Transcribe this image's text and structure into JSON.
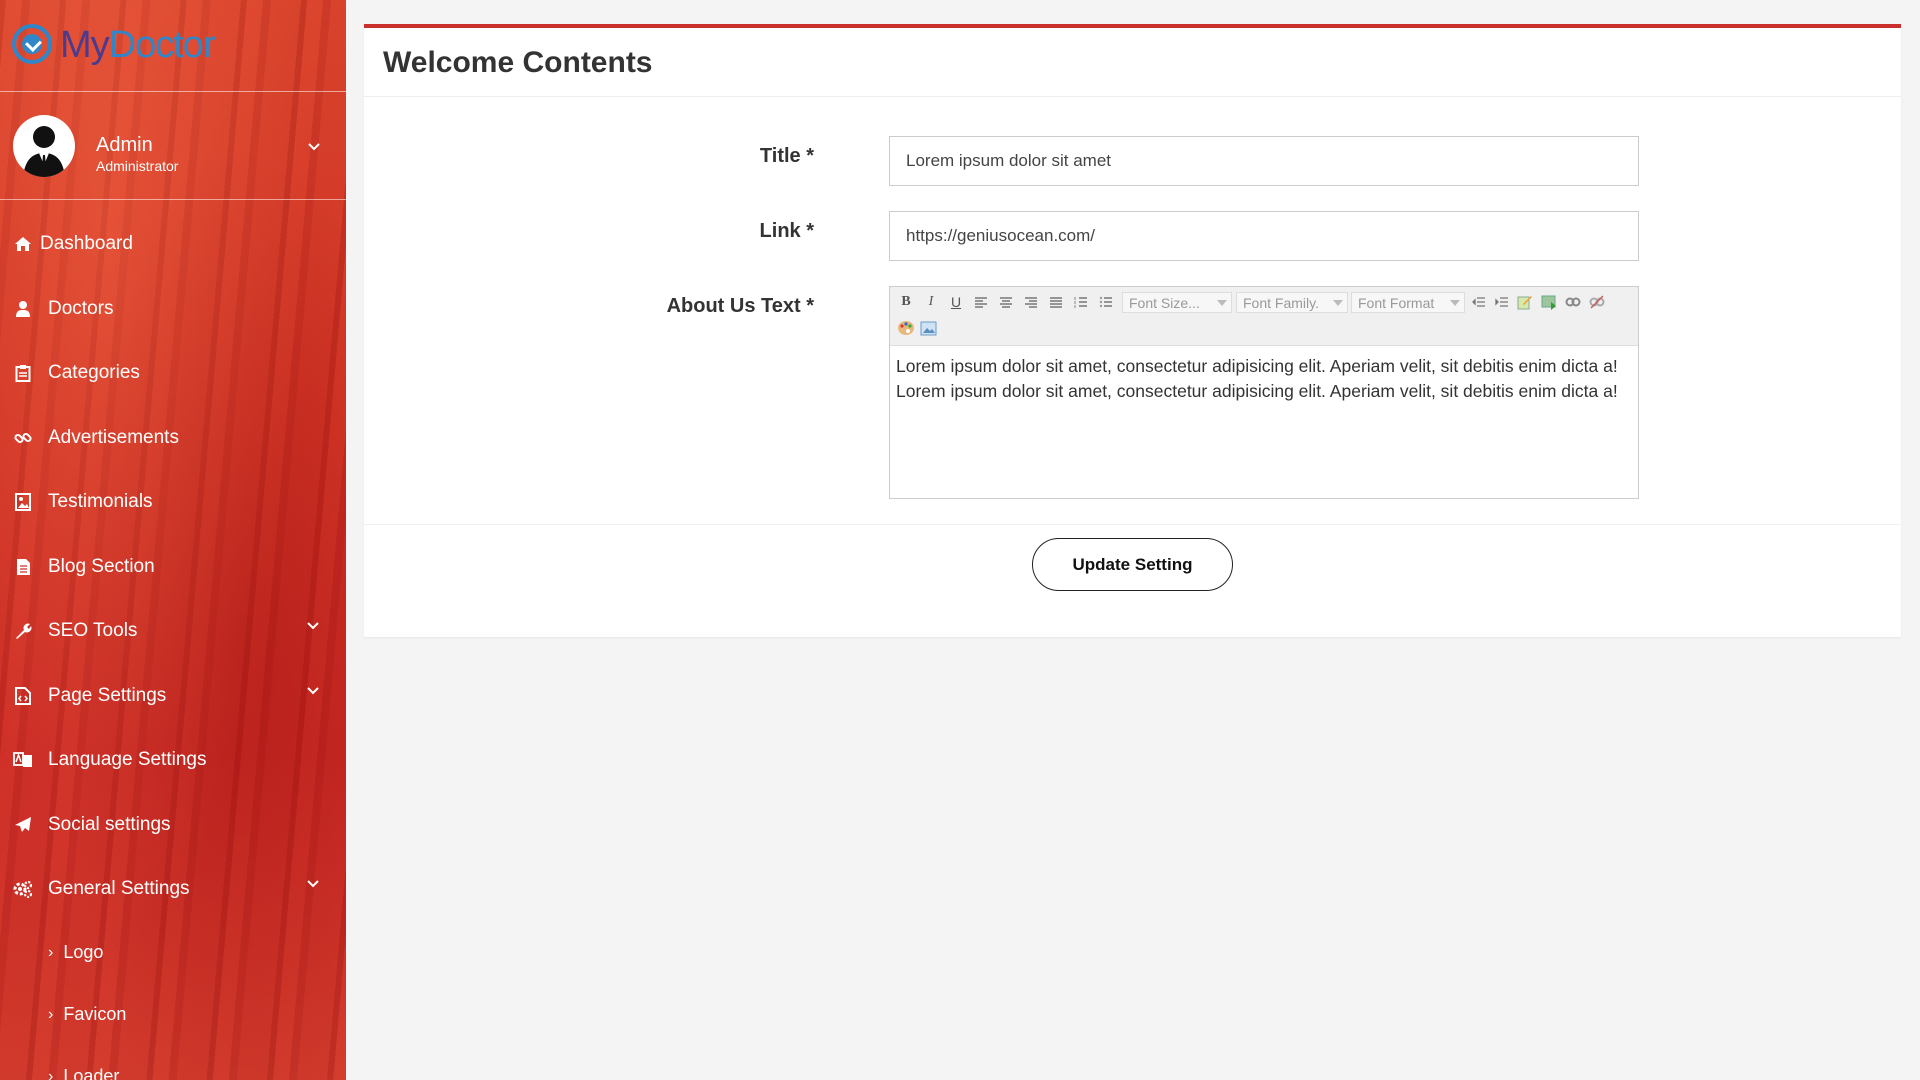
{
  "brand": {
    "part1": "My",
    "part2": "Doctor"
  },
  "profile": {
    "name": "Admin",
    "role": "Administrator"
  },
  "nav": [
    {
      "label": "Dashboard",
      "icon": "home-icon",
      "expandable": false
    },
    {
      "label": "Doctors",
      "icon": "user-md-icon",
      "expandable": false
    },
    {
      "label": "Categories",
      "icon": "clipboard-icon",
      "expandable": false
    },
    {
      "label": "Advertisements",
      "icon": "link-icon",
      "expandable": false
    },
    {
      "label": "Testimonials",
      "icon": "image-icon",
      "expandable": false
    },
    {
      "label": "Blog Section",
      "icon": "file-icon",
      "expandable": false
    },
    {
      "label": "SEO Tools",
      "icon": "wrench-icon",
      "expandable": true
    },
    {
      "label": "Page Settings",
      "icon": "file-code-icon",
      "expandable": true
    },
    {
      "label": "Language Settings",
      "icon": "language-icon",
      "expandable": false
    },
    {
      "label": "Social settings",
      "icon": "paper-plane-icon",
      "expandable": false
    },
    {
      "label": "General Settings",
      "icon": "cogs-icon",
      "expandable": true
    }
  ],
  "general_sub": [
    "Logo",
    "Favicon",
    "Loader"
  ],
  "page": {
    "title": "Welcome Contents",
    "fields": {
      "title_label": "Title *",
      "title_value": "Lorem ipsum dolor sit amet",
      "link_label": "Link *",
      "link_value": "https://geniusocean.com/",
      "about_label": "About Us Text *",
      "about_line1": "Lorem ipsum dolor sit amet, consectetur adipisicing elit. Aperiam velit, sit debitis enim dicta a!",
      "about_line2": "Lorem ipsum dolor sit amet, consectetur adipisicing elit. Aperiam velit, sit debitis enim dicta a!"
    },
    "editor": {
      "font_size": "Font Size...",
      "font_family": "Font Family.",
      "font_format": "Font Format"
    },
    "submit_label": "Update Setting"
  },
  "colors": {
    "accent": "#c9302c",
    "brand_blue": "#2f87c9",
    "brand_purple": "#4a3b8f"
  }
}
